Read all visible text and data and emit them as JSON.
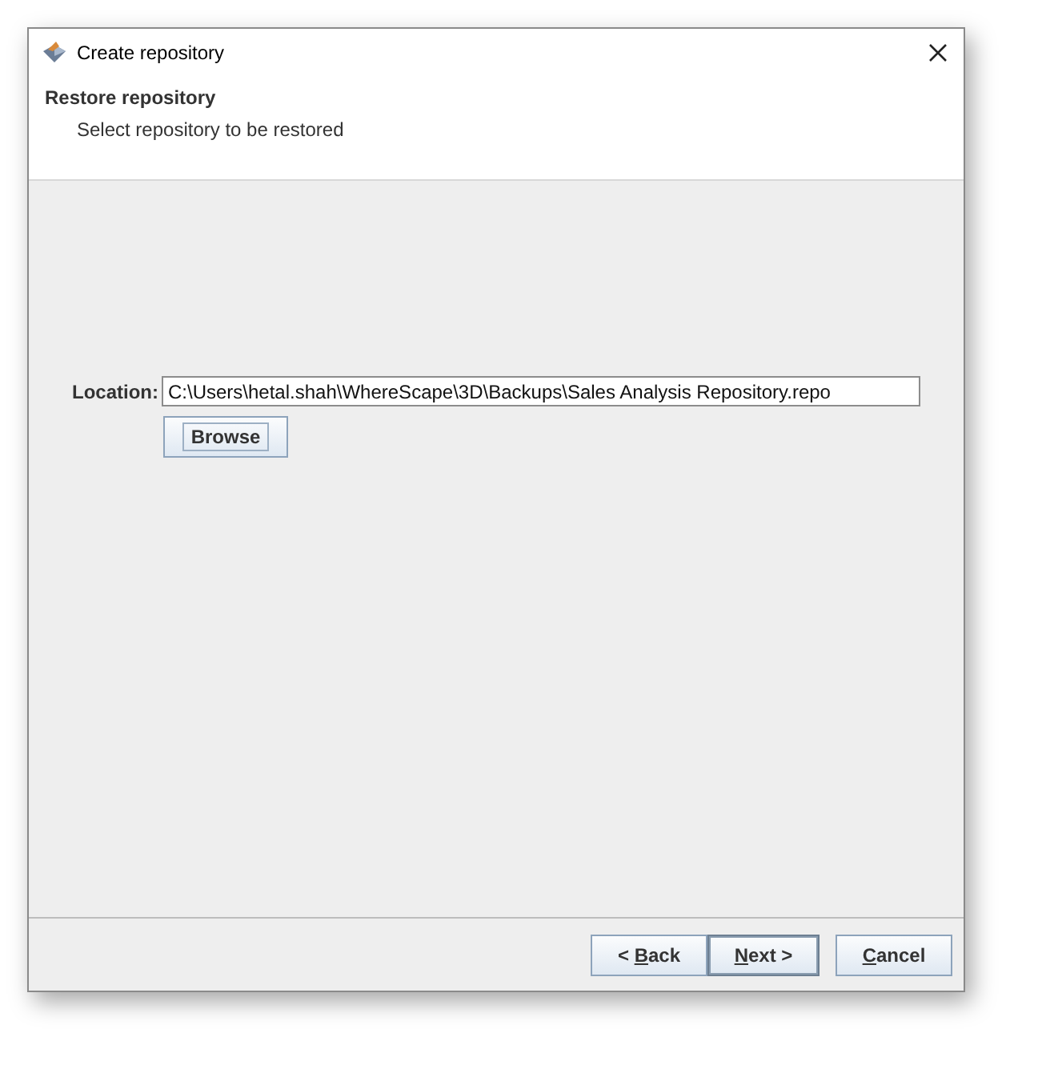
{
  "window": {
    "title": "Create repository"
  },
  "header": {
    "title": "Restore repository",
    "subtitle": "Select repository to be restored"
  },
  "location": {
    "label": "Location:",
    "value": "C:\\Users\\hetal.shah\\WhereScape\\3D\\Backups\\Sales Analysis Repository.repo"
  },
  "browse_button": {
    "label": "Browse",
    "focused": true
  },
  "buttons": [
    {
      "before": "< ",
      "key": "B",
      "after": "ack",
      "default": false
    },
    {
      "key": "N",
      "after": "ext >",
      "default": true
    },
    {
      "key": "C",
      "after": "ancel",
      "default": false
    }
  ]
}
